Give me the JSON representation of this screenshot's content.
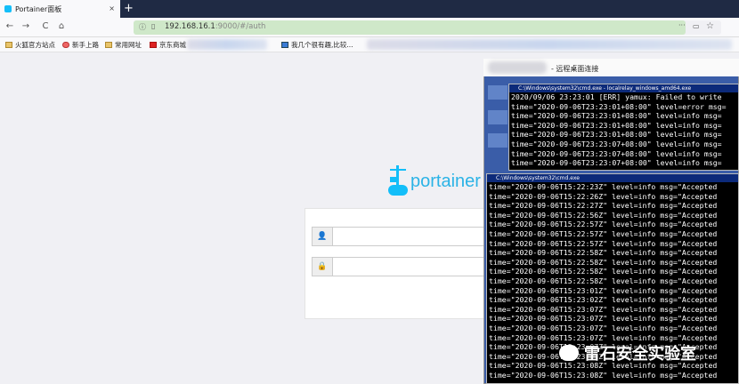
{
  "browser": {
    "tab_title": "Portainer面板",
    "tab_close": "×",
    "new_tab": "+",
    "url_host": "192.168.16.1",
    "url_rest": ":9000/#/auth",
    "nav": {
      "back": "←",
      "forward": "→",
      "reload": "C",
      "home": "⌂"
    },
    "url_icons": {
      "more": "···",
      "shield": "☆",
      "star": "☆"
    },
    "bookmarks": [
      "火狐官方站点",
      "新手上路",
      "常用网址",
      "京东商城",
      "我几个很有趣,比较..."
    ]
  },
  "login": {
    "brand": "portainer",
    "username_icon": "user-icon",
    "password_icon": "lock-icon"
  },
  "remote": {
    "title": "- 远程桌面连接"
  },
  "term1": {
    "title": "C:\\Windows\\system32\\cmd.exe - localrelay_windows_amd64.exe",
    "lines": [
      "2020/09/06 23:23:01 [ERR] yamux: Failed to write",
      "time=\"2020-09-06T23:23:01+08:00\" level=error msg=",
      "time=\"2020-09-06T23:23:01+08:00\" level=info msg=",
      "time=\"2020-09-06T23:23:01+08:00\" level=info msg=",
      "time=\"2020-09-06T23:23:01+08:00\" level=info msg=",
      "time=\"2020-09-06T23:23:07+08:00\" level=info msg=",
      "time=\"2020-09-06T23:23:07+08:00\" level=info msg=",
      "time=\"2020-09-06T23:23:07+08:00\" level=info msg="
    ]
  },
  "term2": {
    "title": "C:\\Windows\\system32\\cmd.exe",
    "lines": [
      "time=\"2020-09-06T15:22:23Z\" level=info msg=\"Accepted",
      "time=\"2020-09-06T15:22:26Z\" level=info msg=\"Accepted",
      "time=\"2020-09-06T15:22:27Z\" level=info msg=\"Accepted",
      "time=\"2020-09-06T15:22:56Z\" level=info msg=\"Accepted",
      "time=\"2020-09-06T15:22:57Z\" level=info msg=\"Accepted",
      "time=\"2020-09-06T15:22:57Z\" level=info msg=\"Accepted",
      "time=\"2020-09-06T15:22:57Z\" level=info msg=\"Accepted",
      "time=\"2020-09-06T15:22:58Z\" level=info msg=\"Accepted",
      "time=\"2020-09-06T15:22:58Z\" level=info msg=\"Accepted",
      "time=\"2020-09-06T15:22:58Z\" level=info msg=\"Accepted",
      "time=\"2020-09-06T15:22:58Z\" level=info msg=\"Accepted",
      "time=\"2020-09-06T15:23:01Z\" level=info msg=\"Accepted",
      "time=\"2020-09-06T15:23:02Z\" level=info msg=\"Accepted",
      "time=\"2020-09-06T15:23:07Z\" level=info msg=\"Accepted",
      "time=\"2020-09-06T15:23:07Z\" level=info msg=\"Accepted",
      "time=\"2020-09-06T15:23:07Z\" level=info msg=\"Accepted",
      "time=\"2020-09-06T15:23:07Z\" level=info msg=\"Accepted",
      "time=\"2020-09-06T15:23:07Z\" level=info msg=\"Accepted",
      "time=\"2020-09-06T15:23:07Z\" level=info msg=\"Accepted",
      "time=\"2020-09-06T15:23:08Z\" level=info msg=\"Accepted",
      "time=\"2020-09-06T15:23:08Z\" level=info msg=\"Accepted"
    ]
  },
  "watermark": "雷石安全实验室"
}
